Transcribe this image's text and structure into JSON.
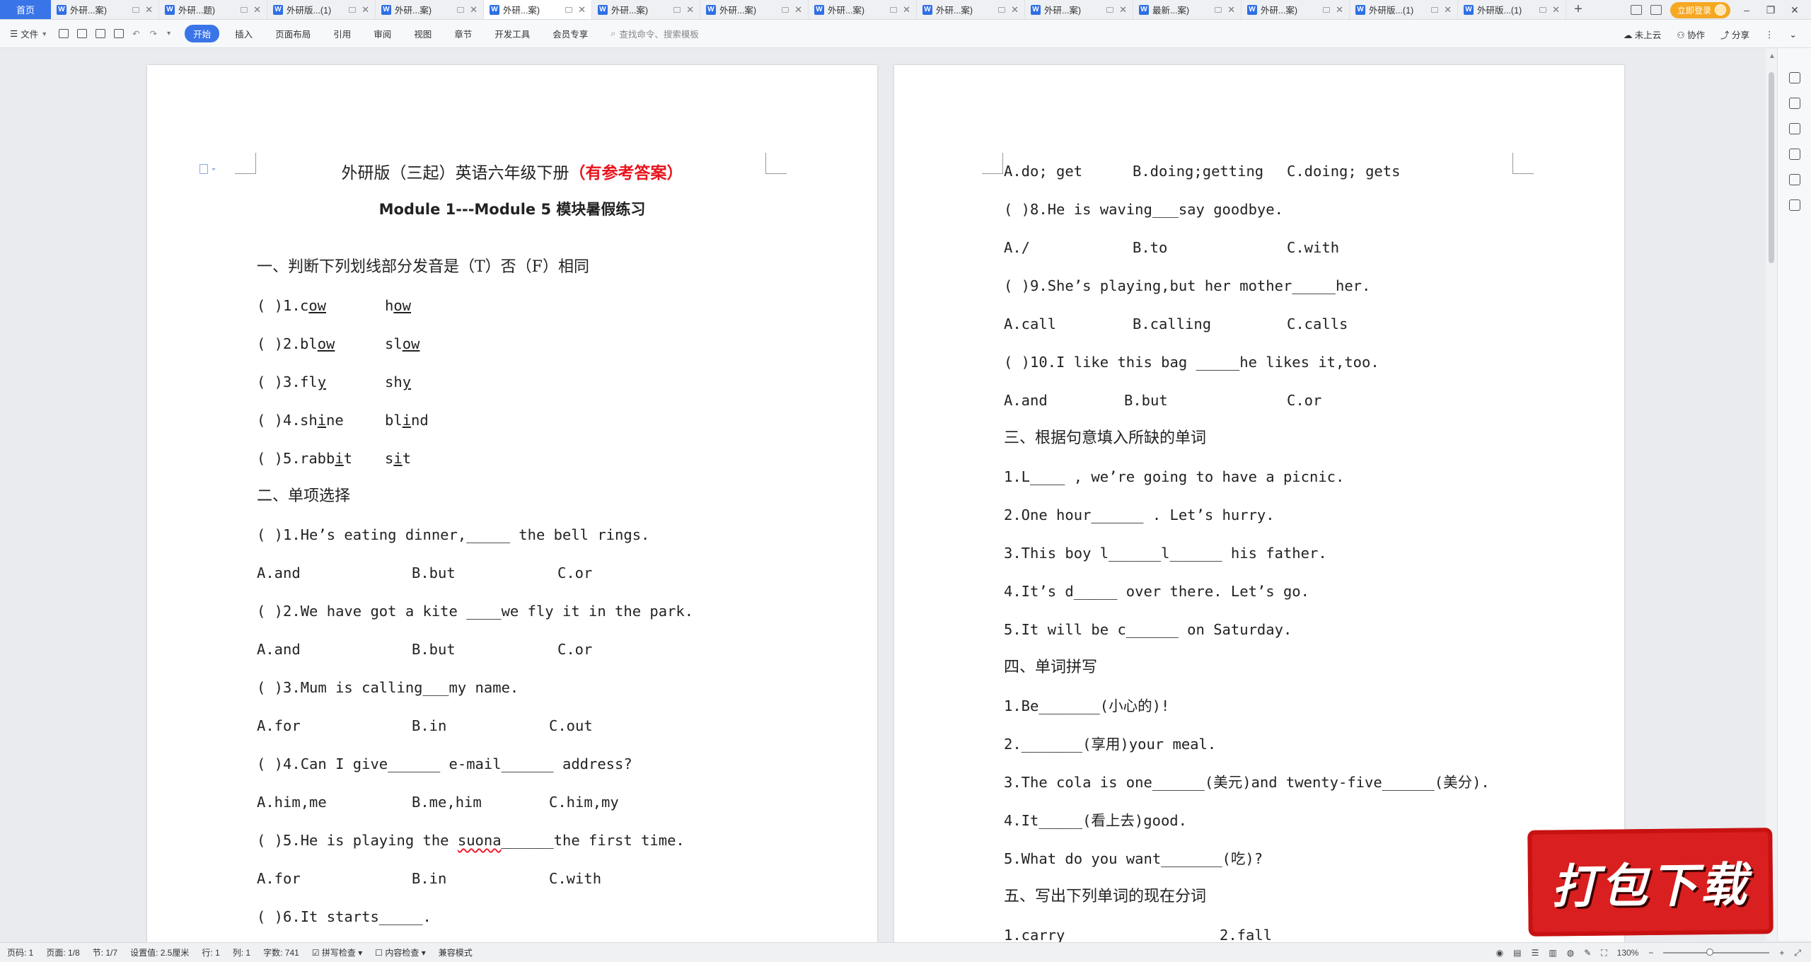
{
  "tabbar": {
    "home_label": "首页",
    "tabs": [
      {
        "label": "外研...案)"
      },
      {
        "label": "外研...题)"
      },
      {
        "label": "外研版...(1)"
      },
      {
        "label": "外研...案)"
      },
      {
        "label": "外研...案)"
      },
      {
        "label": "外研...案)"
      },
      {
        "label": "外研...案)"
      },
      {
        "label": "外研...案)"
      },
      {
        "label": "外研...案)"
      },
      {
        "label": "外研...案)"
      },
      {
        "label": "最新...案)"
      },
      {
        "label": "外研...案)"
      },
      {
        "label": "外研版...(1)"
      },
      {
        "label": "外研版...(1)"
      }
    ],
    "active_tab_index": 4,
    "add_label": "+",
    "login_label": "立即登录"
  },
  "ribbon": {
    "file_label": "文件",
    "tabs": [
      "开始",
      "插入",
      "页面布局",
      "引用",
      "审阅",
      "视图",
      "章节",
      "开发工具",
      "会员专享"
    ],
    "active_tab": "开始",
    "search_placeholder": "查找命令、搜索模板",
    "cloud_label": "未上云",
    "collab_label": "协作",
    "share_label": "分享"
  },
  "page1": {
    "title_main": "外研版（三起）英语六年级下册",
    "title_red": "（有参考答案）",
    "subtitle": "Module 1---Module 5 模块暑假练习",
    "section1": "一、判断下列划线部分发音是（T）否（F）相同",
    "s1_items": [
      {
        "q": "( )1.",
        "w1a": "c",
        "w1u": "ow",
        "w1b": "",
        "w2a": "h",
        "w2u": "ow",
        "w2b": ""
      },
      {
        "q": "( )2.",
        "w1a": "bl",
        "w1u": "ow",
        "w1b": "",
        "w2a": "sl",
        "w2u": "ow",
        "w2b": ""
      },
      {
        "q": "( )3.",
        "w1a": "fl",
        "w1u": "y",
        "w1b": "",
        "w2a": "sh",
        "w2u": "y",
        "w2b": ""
      },
      {
        "q": "( )4.",
        "w1a": "sh",
        "w1u": "i",
        "w1b": "ne",
        "w2a": "bl",
        "w2u": "i",
        "w2b": "nd"
      },
      {
        "q": "( )5.",
        "w1a": "rabb",
        "w1u": "i",
        "w1b": "t",
        "w2a": "s",
        "w2u": "i",
        "w2b": "t"
      }
    ],
    "section2": "二、单项选择",
    "q1": "( )1.He’s eating dinner,_____ the bell rings.",
    "q1_opts": [
      "A.and",
      "B.but",
      "C.or"
    ],
    "q2": "( )2.We have got a kite ____we fly it in the park.",
    "q2_opts": [
      "A.and",
      "B.but",
      "C.or"
    ],
    "q3": "( )3.Mum is calling___my name.",
    "q3_opts": [
      "A.for",
      "B.in",
      "C.out"
    ],
    "q4": "( )4.Can I give______ e-mail______ address?",
    "q4_opts": [
      "A.him,me",
      "B.me,him",
      "C.him,my"
    ],
    "q5_pre": "( )5.He is playing the ",
    "q5_word": "suona",
    "q5_post": "______the first time.",
    "q5_opts": [
      "A.for",
      "B.in",
      "C.with"
    ],
    "q6": "( )6.It starts_____."
  },
  "page2": {
    "q6_opts": [
      "A.do; get",
      "B.doing;getting",
      "C.doing; gets"
    ],
    "q8": "( )8.He is waving___say goodbye.",
    "q8_opts": [
      "A./",
      "B.to",
      "C.with"
    ],
    "q9": "( )9.She’s playing,but her mother_____her.",
    "q9_opts": [
      "A.call",
      "B.calling",
      "C.calls"
    ],
    "q10": "( )10.I like this bag _____he likes it,too.",
    "q10_opts": [
      "A.and",
      "B.but",
      "C.or"
    ],
    "section3": "三、根据句意填入所缺的单词",
    "s3_items": [
      "1.L____ , we’re going to have a picnic.",
      "2.One hour______ . Let’s hurry.",
      "3.This boy l______l______ his father.",
      "4.It’s d_____ over there. Let’s go.",
      "5.It will be c______ on Saturday."
    ],
    "section4": "四、单词拼写",
    "s4_items": [
      "1.Be_______(小心的)!",
      "2._______(享用)your meal.",
      "3.The cola is one______(美元)and twenty-five______(美分).",
      "4.It_____(看上去)good.",
      "5.What do you want_______(吃)?"
    ],
    "section5": "五、写出下列单词的现在分词",
    "s5_items": [
      "1.carry",
      "2.fall"
    ]
  },
  "sticker_text": "打包下载",
  "status": {
    "page_num": "页码: 1",
    "pages": "页面: 1/8",
    "section": "节: 1/7",
    "setting": "设置值: 2.5厘米",
    "row": "行: 1",
    "col": "列: 1",
    "words": "字数: 741",
    "spell": "拼写检查",
    "content": "内容检查",
    "compat": "兼容模式",
    "zoom": "130%",
    "zoom_fraction": 0.43
  }
}
